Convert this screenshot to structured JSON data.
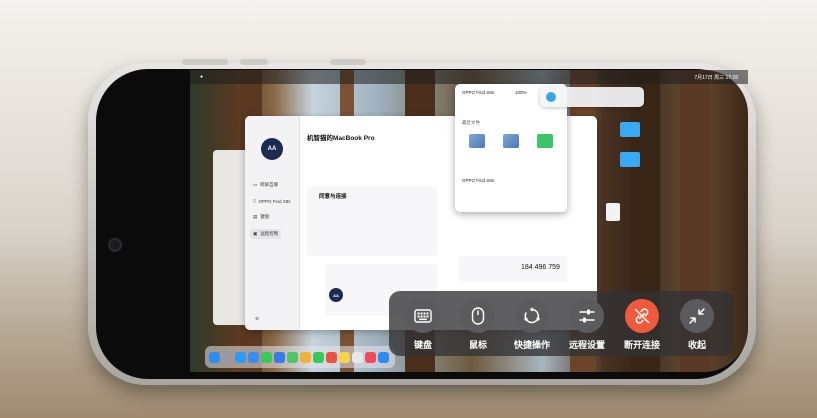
{
  "control_panel": {
    "items": [
      {
        "label": "键盘",
        "icon": "keyboard-icon"
      },
      {
        "label": "鼠标",
        "icon": "mouse-icon"
      },
      {
        "label": "快捷操作",
        "icon": "quick-action-icon"
      },
      {
        "label": "远程设置",
        "icon": "sliders-icon"
      },
      {
        "label": "断开连接",
        "icon": "disconnect-icon"
      },
      {
        "label": "收起",
        "icon": "collapse-icon"
      }
    ],
    "disconnect_color": "#f05a3c"
  },
  "mac": {
    "menubar_time": "7月17日 周三 17:28",
    "app": {
      "device_name": "机智猫的MacBook Pro",
      "sidebar": [
        "跨屏互联",
        "OPPO Find X8s",
        "键盘",
        "远程控制"
      ],
      "section_title": "同意与连接",
      "stat_value": "184 496 759",
      "avatar_text": "AA"
    },
    "popup": {
      "device": "OPPO Find X8s",
      "battery": "100%",
      "files_label": "最近文件"
    }
  }
}
